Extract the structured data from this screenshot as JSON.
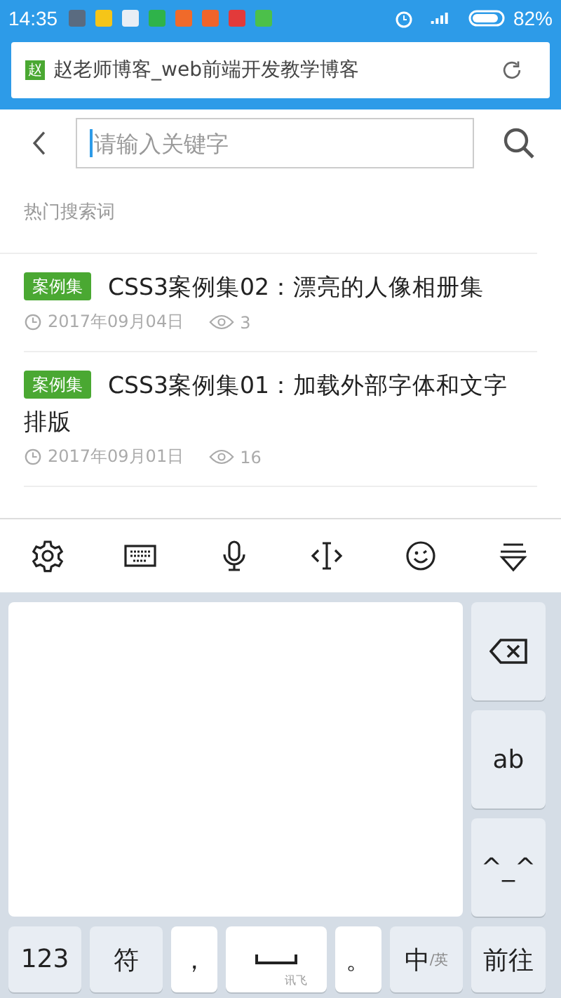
{
  "status_bar": {
    "time": "14:35",
    "battery": "82%"
  },
  "address_bar": {
    "badge": "赵",
    "title": "赵老师博客_web前端开发教学博客"
  },
  "search": {
    "placeholder": "请输入关键字"
  },
  "hot_label": "热门搜索词",
  "articles": [
    {
      "tag": "案例集",
      "title": "CSS3案例集02：漂亮的人像相册集",
      "date": "2017年09月04日",
      "views": "3"
    },
    {
      "tag": "案例集",
      "title": "CSS3案例集01：加载外部字体和文字排版",
      "date": "2017年09月01日",
      "views": "16"
    }
  ],
  "keyboard": {
    "side_keys": [
      {
        "kind": "icon"
      },
      {
        "kind": "text",
        "label": "ab"
      },
      {
        "kind": "text",
        "label": "^_^"
      }
    ],
    "bottom_keys": [
      {
        "kind": "text",
        "label": "123",
        "white": false
      },
      {
        "kind": "text",
        "label": "符",
        "white": false
      },
      {
        "kind": "text",
        "label": "，",
        "white": true
      },
      {
        "kind": "space",
        "label": "讯飞",
        "white": true
      },
      {
        "kind": "text",
        "label": "。",
        "white": true
      },
      {
        "kind": "lang",
        "label": "中",
        "sub": "/英",
        "white": false
      },
      {
        "kind": "text",
        "label": "前往",
        "white": false
      }
    ]
  }
}
